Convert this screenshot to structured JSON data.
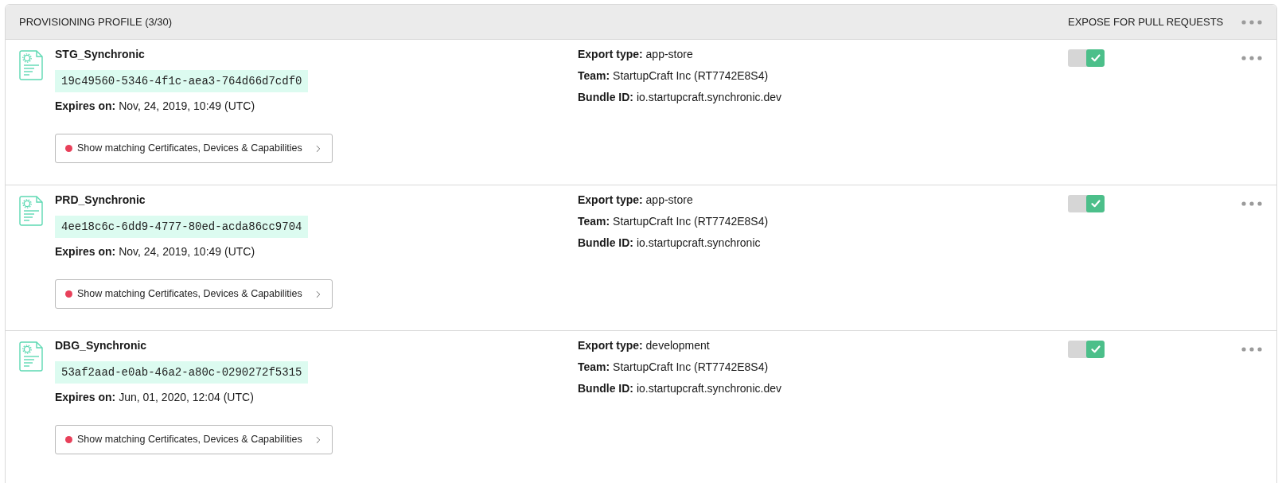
{
  "header": {
    "title": "PROVISIONING PROFILE (3/30)",
    "expose_label": "EXPOSE FOR PULL REQUESTS"
  },
  "profiles": [
    {
      "name": "STG_Synchronic",
      "uuid": "19c49560-5346-4f1c-aea3-764d66d7cdf0",
      "expiry": {
        "label": "Expires on:",
        "value": "Nov, 24, 2019, 10:49 (UTC)"
      },
      "match_button": {
        "label": "Show matching Certificates, Devices & Capabilities",
        "color": "#e8405a"
      },
      "details": [
        {
          "label": "Export type:",
          "value": "app-store"
        },
        {
          "label": "Team:",
          "value": "StartupCraft Inc (RT7742E8S4)"
        },
        {
          "label": "Bundle ID:",
          "value": "io.startupcraft.synchronic.dev"
        }
      ],
      "exposed": true
    },
    {
      "name": "PRD_Synchronic",
      "uuid": "4ee18c6c-6dd9-4777-80ed-acda86cc9704",
      "expiry": {
        "label": "Expires on:",
        "value": "Nov, 24, 2019, 10:49 (UTC)"
      },
      "match_button": {
        "label": "Show matching Certificates, Devices & Capabilities",
        "color": "#e8405a"
      },
      "details": [
        {
          "label": "Export type:",
          "value": "app-store"
        },
        {
          "label": "Team:",
          "value": "StartupCraft Inc (RT7742E8S4)"
        },
        {
          "label": "Bundle ID:",
          "value": "io.startupcraft.synchronic"
        }
      ],
      "exposed": true
    },
    {
      "name": "DBG_Synchronic",
      "uuid": "53af2aad-e0ab-46a2-a80c-0290272f5315",
      "expiry": {
        "label": "Expires on:",
        "value": "Jun, 01, 2020, 12:04 (UTC)"
      },
      "match_button": {
        "label": "Show matching Certificates, Devices & Capabilities",
        "color": "#e8405a"
      },
      "details": [
        {
          "label": "Export type:",
          "value": "development"
        },
        {
          "label": "Team:",
          "value": "StartupCraft Inc (RT7742E8S4)"
        },
        {
          "label": "Bundle ID:",
          "value": "io.startupcraft.synchronic.dev"
        }
      ],
      "exposed": true
    }
  ]
}
